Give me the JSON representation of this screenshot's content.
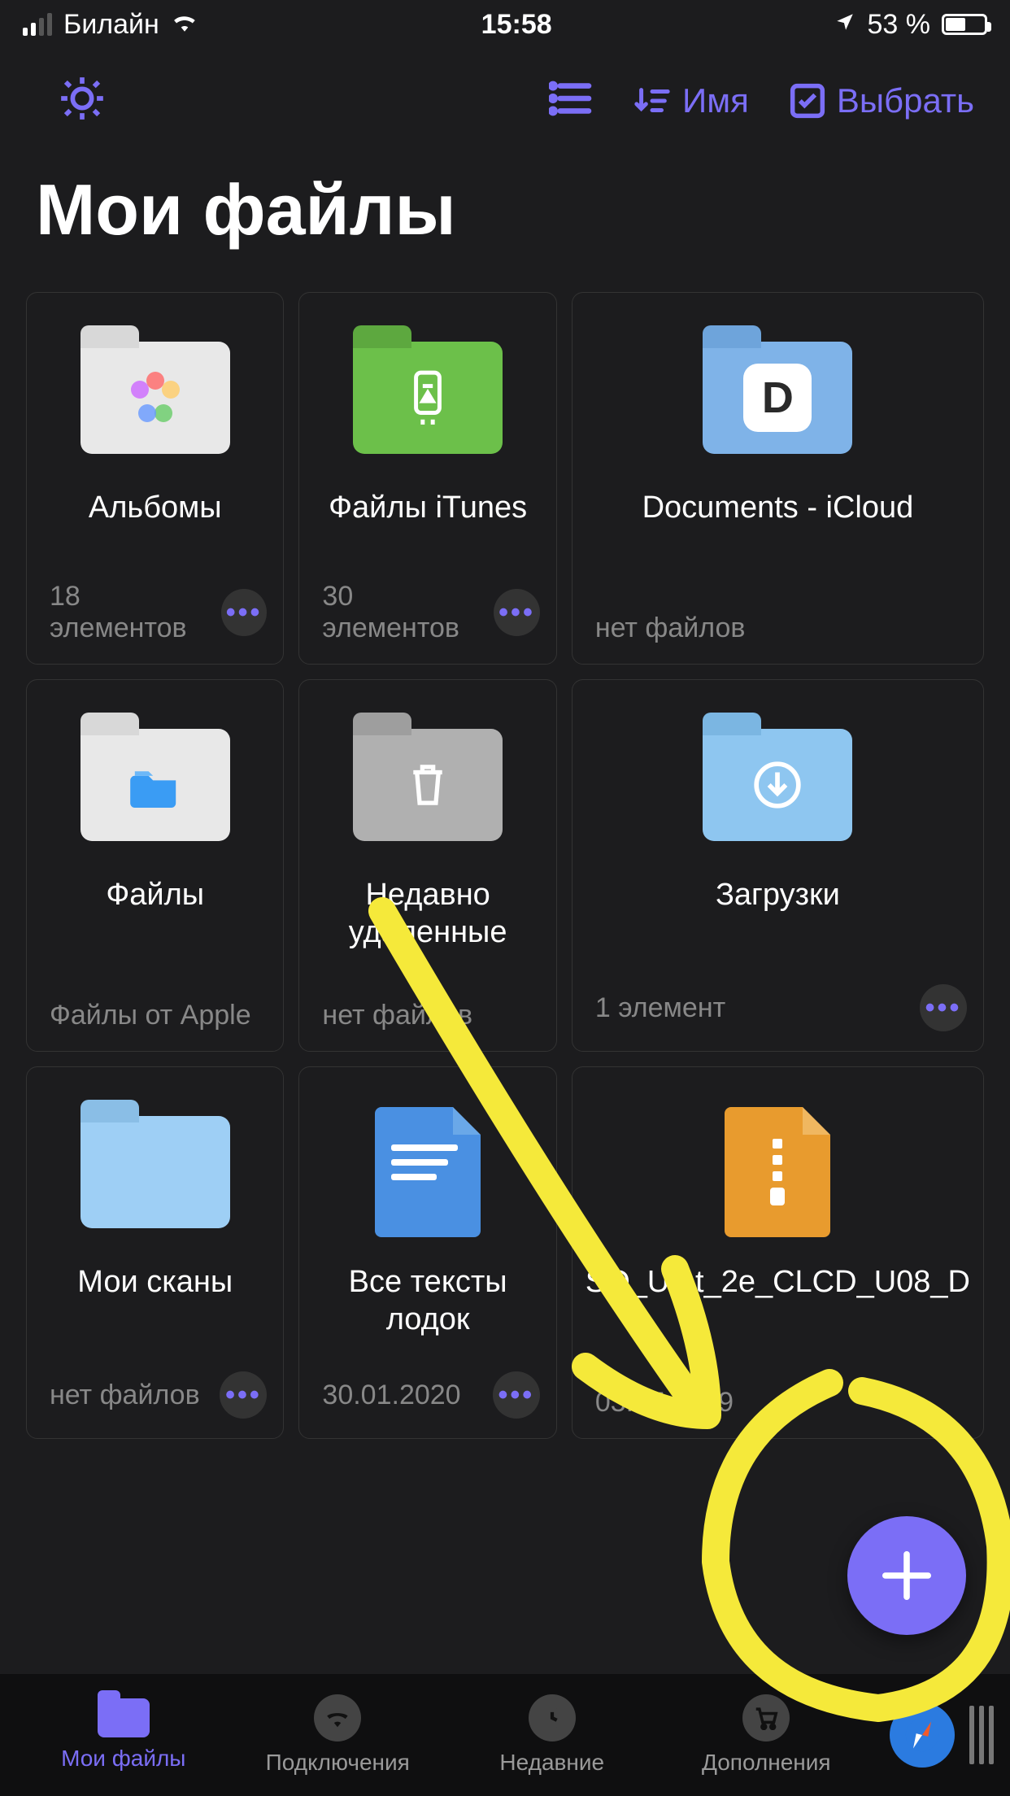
{
  "status": {
    "carrier": "Билайн",
    "time": "15:58",
    "battery_text": "53 %",
    "battery_pct": 53
  },
  "toolbar": {
    "sort_label": "Имя",
    "select_label": "Выбрать"
  },
  "page": {
    "title": "Мои файлы"
  },
  "tiles": [
    {
      "label": "Альбомы",
      "sub": "18 элементов",
      "has_more": true
    },
    {
      "label": "Файлы iTunes",
      "sub": "30 элементов",
      "has_more": true
    },
    {
      "label": "Documents - iCloud",
      "sub": "нет файлов",
      "has_more": false
    },
    {
      "label": "Файлы",
      "sub": "Файлы от Apple",
      "has_more": false
    },
    {
      "label": "Недавно удаленные",
      "sub": "нет файлов",
      "has_more": false
    },
    {
      "label": "Загрузки",
      "sub": "1 элемент",
      "has_more": true
    },
    {
      "label": "Мои сканы",
      "sub": "нет файлов",
      "has_more": true
    },
    {
      "label": "Все тексты лодок",
      "sub": "30.01.2020",
      "has_more": true
    },
    {
      "label": "SO_UInt_2e_CLCD_U08_D",
      "sub": "03.07.2019",
      "has_more": false
    }
  ],
  "tabs": {
    "my_files": "Мои файлы",
    "connections": "Подключения",
    "recent": "Недавние",
    "addons": "Дополнения"
  }
}
